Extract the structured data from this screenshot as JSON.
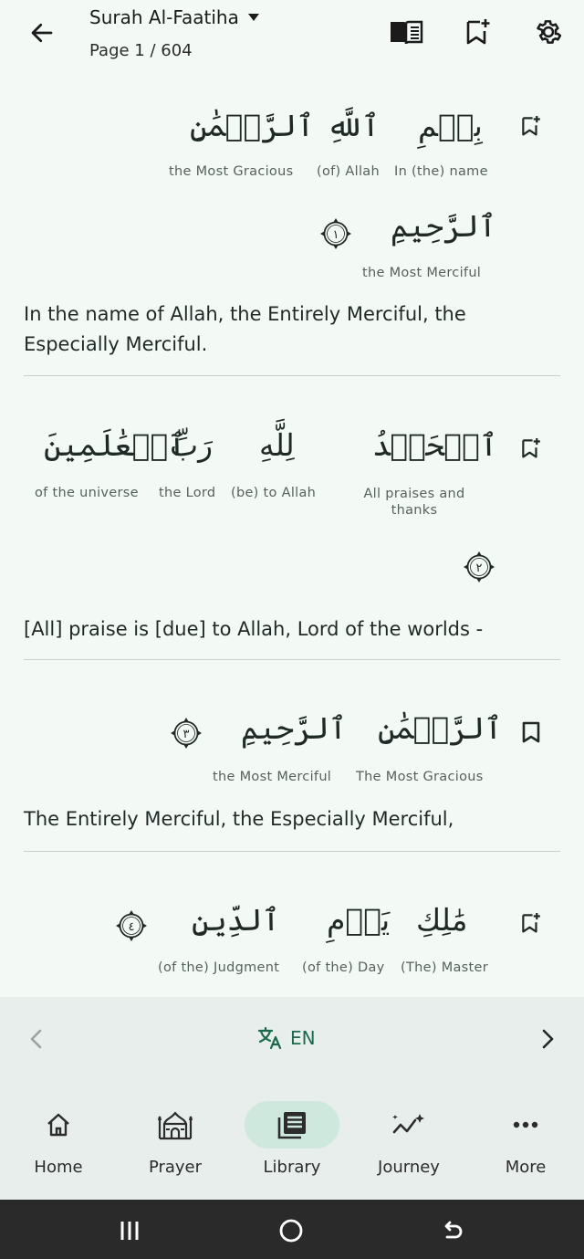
{
  "header": {
    "surah_title": "Surah Al-Faatiha",
    "page_label": "Page 1 / 604"
  },
  "verses": [
    {
      "words": [
        {
          "arabic": "بِسۡمِ",
          "gloss": "In (the) name"
        },
        {
          "arabic": "ٱللَّهِ",
          "gloss": "(of) Allah"
        },
        {
          "arabic": "ٱلرَّحۡمَٰنِ",
          "gloss": "the Most Gracious"
        },
        {
          "arabic": "ٱلرَّحِيمِ",
          "gloss": "the Most Merciful"
        }
      ],
      "marker": "١",
      "translation": "In the name of Allah, the Entirely Merciful, the Especially Merciful."
    },
    {
      "words": [
        {
          "arabic": "ٱلۡحَمۡدُ",
          "gloss": "All praises and thanks"
        },
        {
          "arabic": "لِلَّهِ",
          "gloss": "(be) to Allah"
        },
        {
          "arabic": "رَبِّ",
          "gloss": "the Lord"
        },
        {
          "arabic": "ٱلۡعَٰلَمِينَ",
          "gloss": "of the universe"
        }
      ],
      "marker": "٢",
      "translation": "[All] praise is [due] to Allah, Lord of the worlds -"
    },
    {
      "words": [
        {
          "arabic": "ٱلرَّحۡمَٰنِ",
          "gloss": "The Most Gracious"
        },
        {
          "arabic": "ٱلرَّحِيمِ",
          "gloss": "the Most Merciful"
        }
      ],
      "marker": "٣",
      "translation": "The Entirely Merciful, the Especially Merciful,"
    },
    {
      "words": [
        {
          "arabic": "مَٰلِكِ",
          "gloss": "(The) Master"
        },
        {
          "arabic": "يَوۡمِ",
          "gloss": "(of the) Day"
        },
        {
          "arabic": "ٱلدِّينِ",
          "gloss": "(of the) Judgment"
        }
      ],
      "marker": "٤"
    }
  ],
  "bottom": {
    "language": "EN"
  },
  "nav": [
    {
      "label": "Home",
      "icon": "home-icon"
    },
    {
      "label": "Prayer",
      "icon": "mosque-icon"
    },
    {
      "label": "Library",
      "icon": "library-icon",
      "active": true
    },
    {
      "label": "Journey",
      "icon": "journey-icon"
    },
    {
      "label": "More",
      "icon": "more-icon"
    }
  ],
  "colors": {
    "background": "#f3faf6",
    "accent": "#1c6a4e",
    "active_pill": "#cfe8de",
    "system_bar": "#2a2a2a"
  }
}
